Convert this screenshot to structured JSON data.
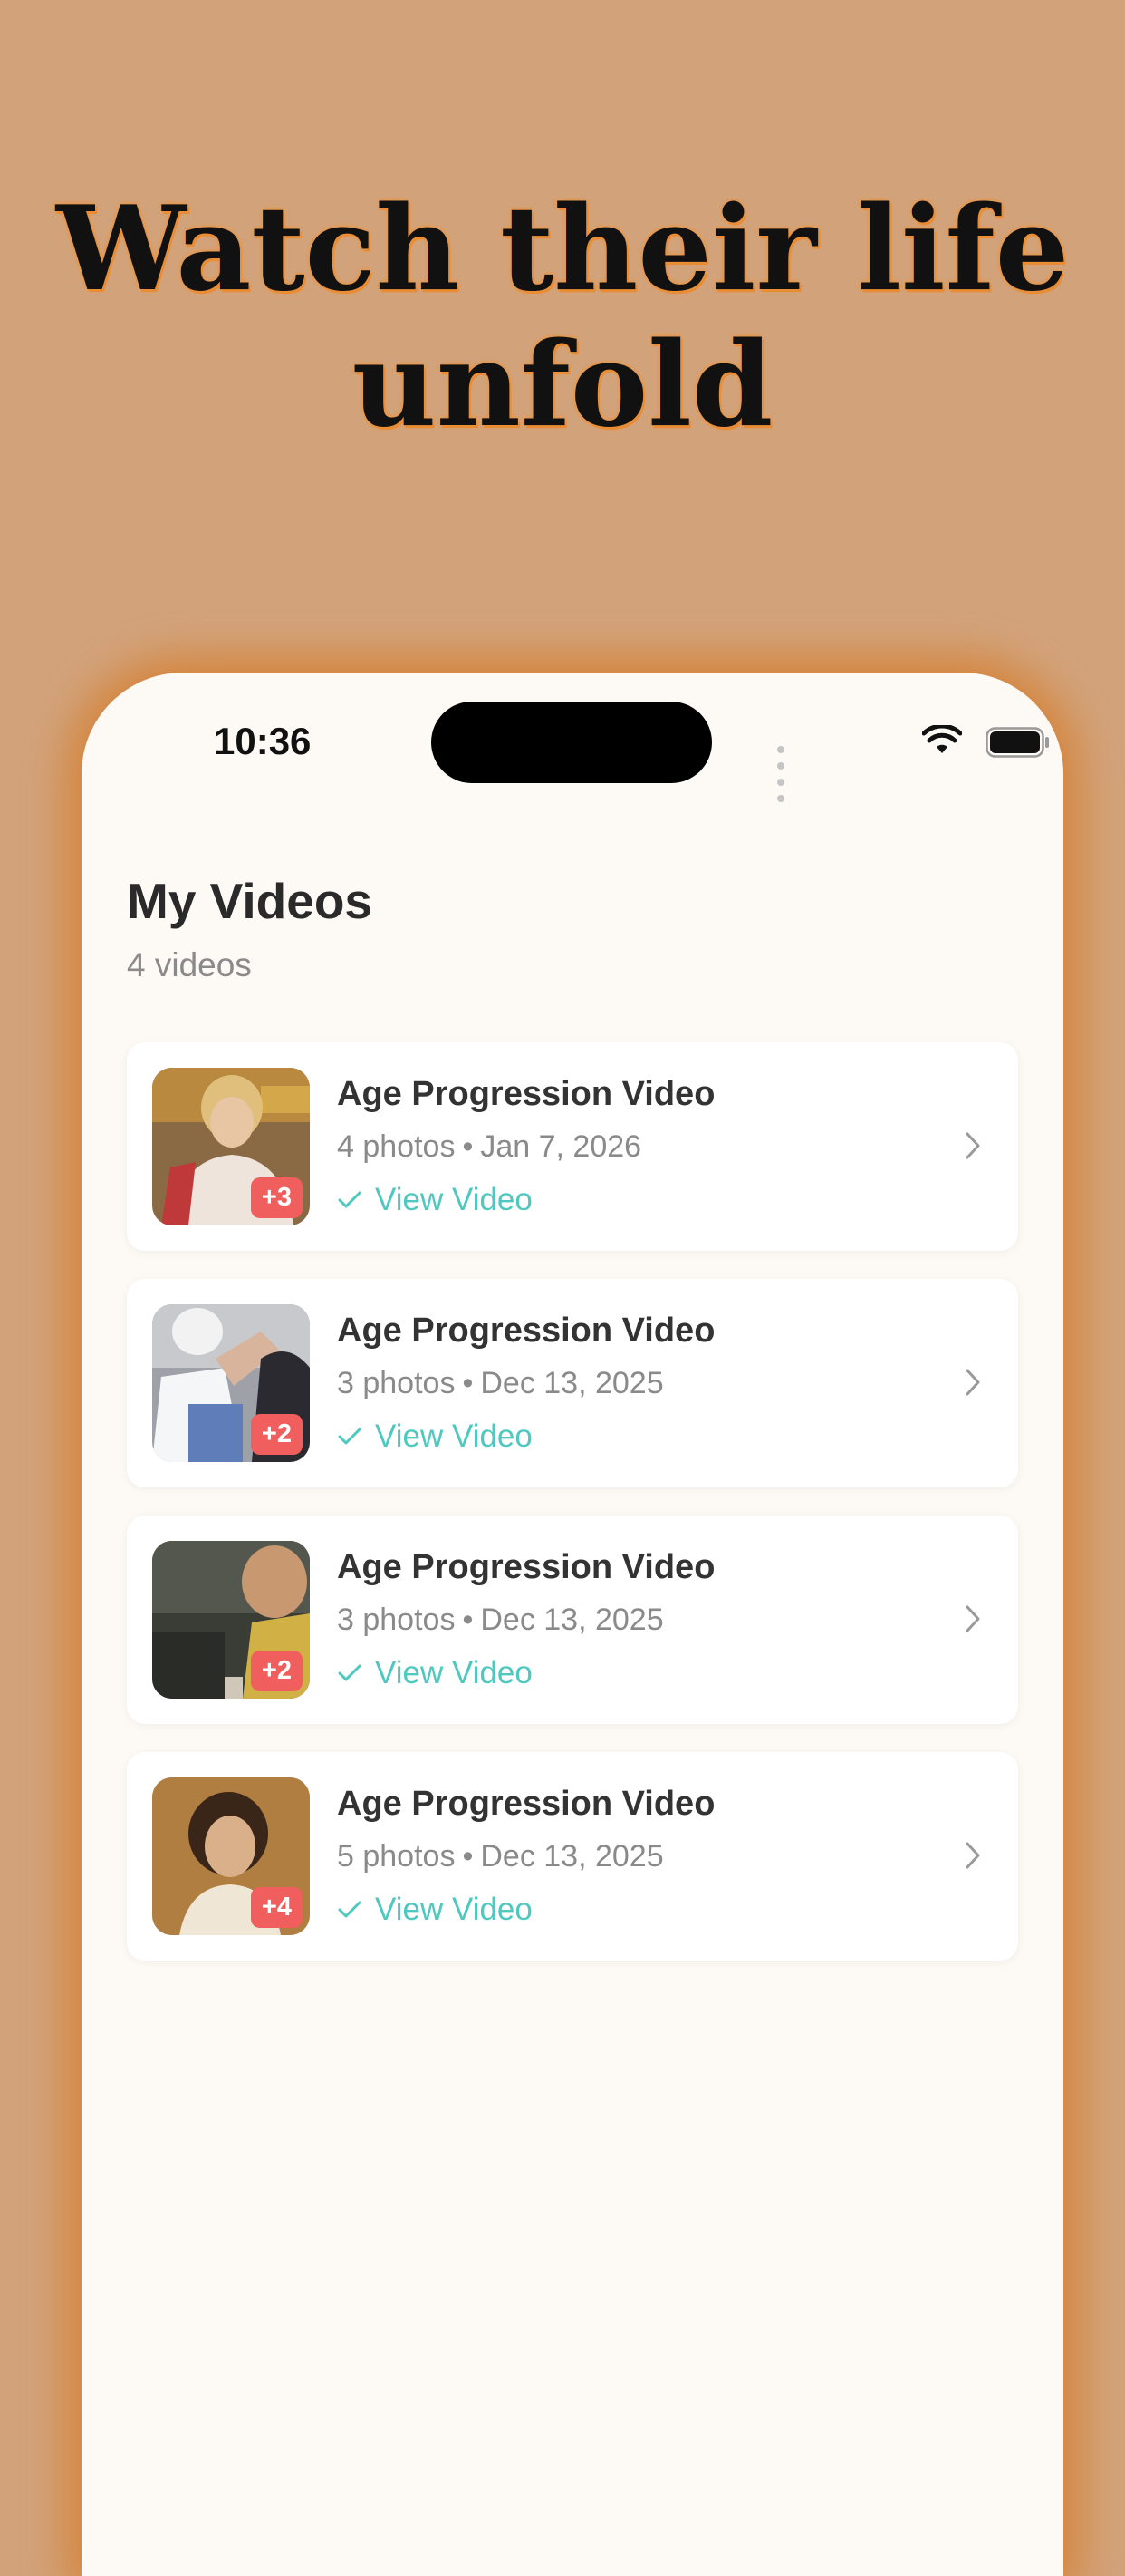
{
  "headline": {
    "line1": "Watch their life",
    "line2": "unfold"
  },
  "status_bar": {
    "time": "10:36",
    "icons": [
      "signal-dots-icon",
      "wifi-icon",
      "battery-icon"
    ]
  },
  "screen": {
    "title": "My Videos",
    "count": "4 videos"
  },
  "videos": [
    {
      "title": "Age Progression Video",
      "photos": "4 photos",
      "date": "Jan 7, 2026",
      "badge": "+3",
      "action": "View Video"
    },
    {
      "title": "Age Progression Video",
      "photos": "3 photos",
      "date": "Dec 13, 2025",
      "badge": "+2",
      "action": "View Video"
    },
    {
      "title": "Age Progression Video",
      "photos": "3 photos",
      "date": "Dec 13, 2025",
      "badge": "+2",
      "action": "View Video"
    },
    {
      "title": "Age Progression Video",
      "photos": "5 photos",
      "date": "Dec 13, 2025",
      "badge": "+4",
      "action": "View Video"
    }
  ],
  "meta_separator": "•",
  "colors": {
    "background": "#d2a37b",
    "headline_glow": "#ec8f35",
    "screen_bg": "#fdf9f5",
    "accent": "#4fc8c0",
    "badge": "#f05e5e"
  }
}
